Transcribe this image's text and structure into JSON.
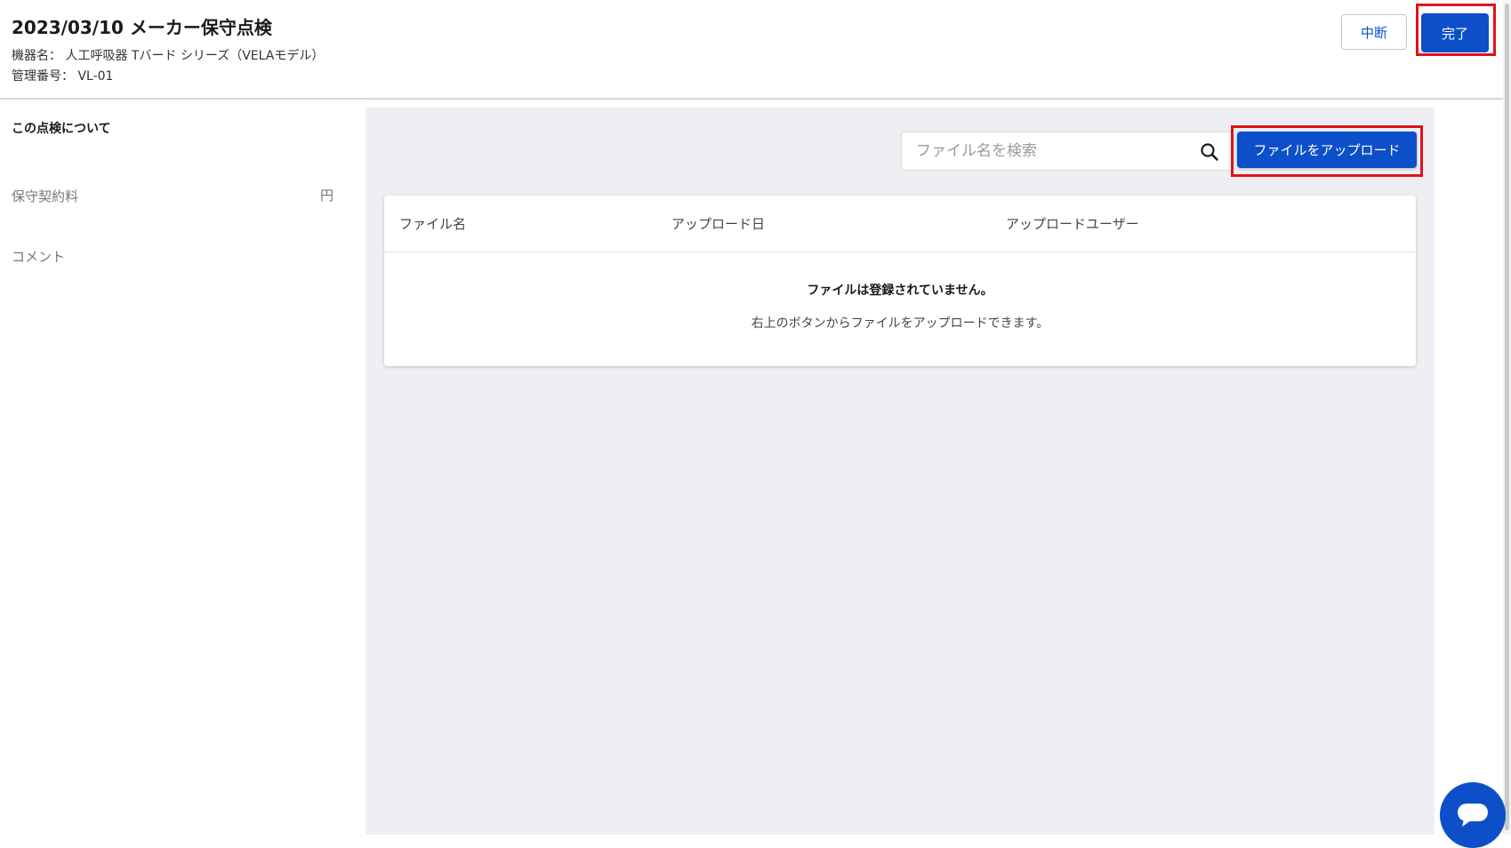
{
  "header": {
    "title": "2023/03/10 メーカー保守点検",
    "device_line": "機器名： 人工呼吸器 Tバード シリーズ（VELAモデル）",
    "management_line": "管理番号： VL-01",
    "suspend_label": "中断",
    "complete_label": "完了"
  },
  "sidebar": {
    "heading": "この点検について",
    "fee_label": "保守契約料",
    "fee_unit": "円",
    "comment_label": "コメント"
  },
  "search": {
    "placeholder": "ファイル名を検索",
    "icon": "search-icon"
  },
  "upload": {
    "label": "ファイルをアップロード"
  },
  "table": {
    "columns": [
      "ファイル名",
      "アップロード日",
      "アップロードユーザー"
    ],
    "empty_title": "ファイルは登録されていません。",
    "empty_description": "右上のボタンからファイルをアップロードできます。"
  },
  "chat": {
    "icon": "chat-bubble-icon"
  },
  "colors": {
    "primary": "#0d4fc9",
    "highlight": "#e0121b",
    "main_background": "#eeeff3"
  }
}
